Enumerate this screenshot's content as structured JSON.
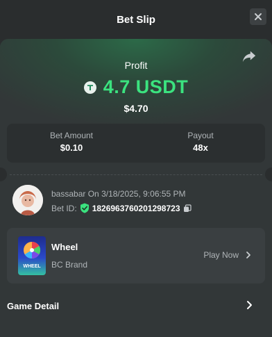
{
  "header": {
    "title": "Bet Slip",
    "close_icon": "close-icon"
  },
  "summary": {
    "profit_label": "Profit",
    "currency_icon": "usdt-tether-icon",
    "profit_value": "4.7 USDT",
    "profit_fiat": "$4.70",
    "accent_color": "#3be37f",
    "bet_amount_label": "Bet Amount",
    "bet_amount_value": "$0.10",
    "payout_label": "Payout",
    "payout_value": "48x",
    "share_icon": "share-icon"
  },
  "bet": {
    "username": "bassabar",
    "on_text": "On",
    "datetime": "3/18/2025, 9:06:55 PM",
    "bet_id_label": "Bet ID:",
    "bet_id": "1826963760201298723",
    "verified_icon": "shield-check-icon",
    "copy_icon": "copy-icon"
  },
  "game": {
    "thumb_label": "WHEEL",
    "name": "Wheel",
    "brand": "BC Brand",
    "play_label": "Play Now",
    "play_icon": "chevron-right-icon"
  },
  "footer": {
    "game_detail_label": "Game Detail",
    "game_detail_icon": "chevron-right-icon"
  }
}
